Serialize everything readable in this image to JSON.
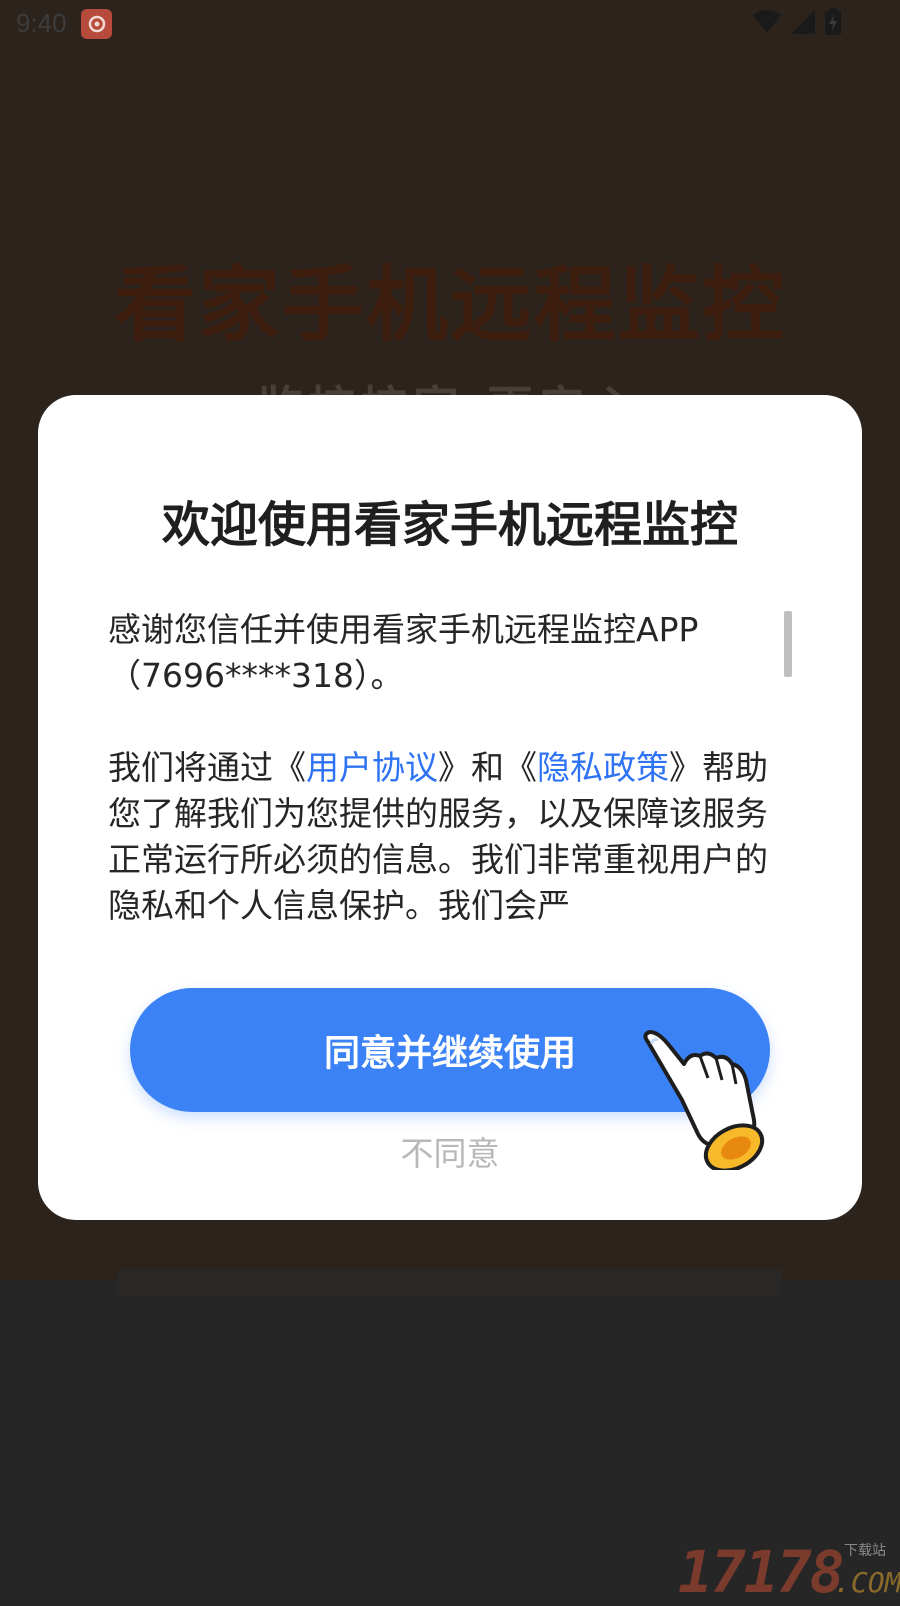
{
  "status_bar": {
    "time": "9:40",
    "icons": [
      "app-notification-icon",
      "wifi-icon",
      "cellular-signal-icon",
      "battery-charging-icon"
    ]
  },
  "background_app": {
    "title": "看家手机远程监控",
    "subtitle": "监控控家 更安心"
  },
  "dialog": {
    "title": "欢迎使用看家手机远程监控",
    "paragraph1": "感谢您信任并使用看家手机远程监控APP（7696****318）。",
    "paragraph2_prefix": "我们将通过《",
    "user_agreement_link": "用户协议",
    "paragraph2_mid": "》和《",
    "privacy_policy_link": "隐私政策",
    "paragraph2_suffix": "》帮助您了解我们为您提供的服务，以及保障该服务正常运行所必须的信息。我们非常重视用户的隐私和个人信息保护。我们会严",
    "agree_button": "同意并继续使用",
    "disagree_button": "不同意"
  },
  "watermark": {
    "digits": "17178",
    "small_text": "下载站",
    "domain": ".COM"
  },
  "colors": {
    "accent": "#3b82f7",
    "link": "#2f73f5",
    "overlay_bg": "#2c231d"
  }
}
